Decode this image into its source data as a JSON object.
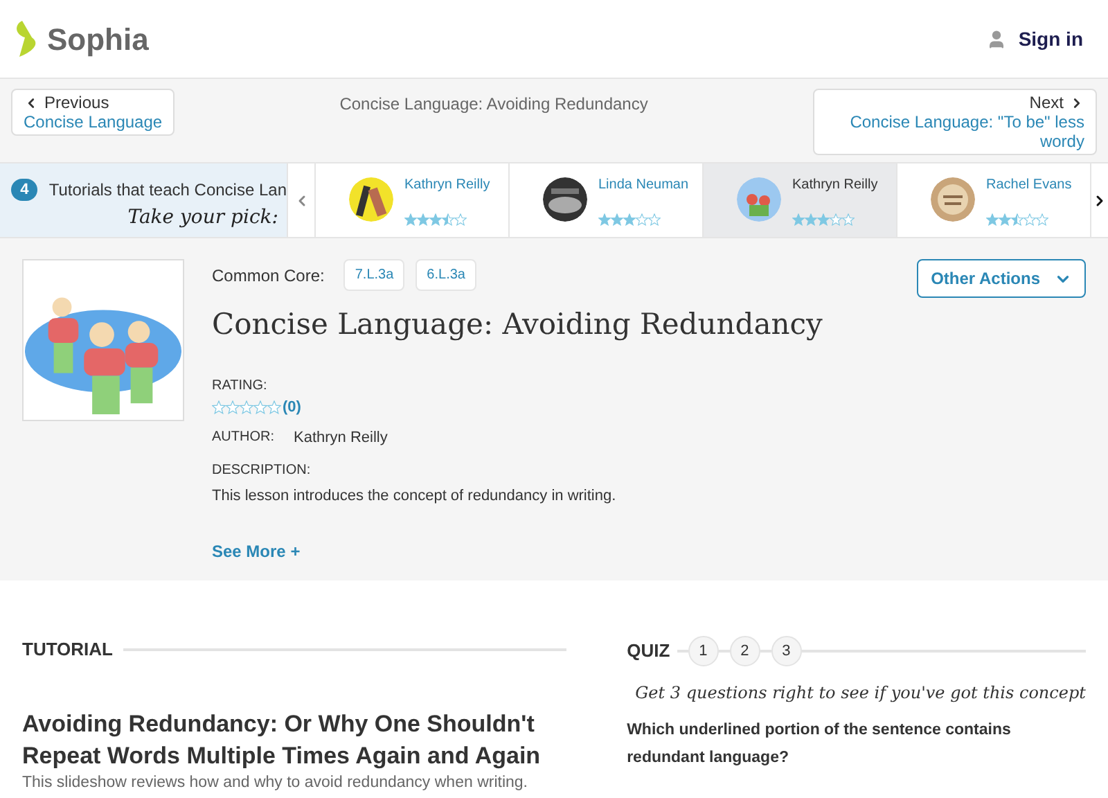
{
  "header": {
    "logo": "Sophia",
    "sign_in": "Sign in"
  },
  "nav": {
    "previous_label": "Previous",
    "previous_title": "Concise Language",
    "current": "Concise Language: Avoiding Redundancy",
    "next_label": "Next",
    "next_title": "Concise Language: \"To be\" less wordy"
  },
  "carousel": {
    "count": "4",
    "intro": "Tutorials that teach Concise Lan",
    "pick": "Take your pick:",
    "items": [
      {
        "name": "Kathryn Reilly",
        "stars": 3.5,
        "selected": false
      },
      {
        "name": "Linda Neuman",
        "stars": 3,
        "selected": false
      },
      {
        "name": "Kathryn Reilly",
        "stars": 3,
        "selected": true
      },
      {
        "name": "Rachel Evans",
        "stars": 2.5,
        "selected": false
      }
    ]
  },
  "lesson": {
    "common_core_label": "Common Core:",
    "standards": [
      "7.L.3a",
      "6.L.3a"
    ],
    "other_actions": "Other Actions",
    "title": "Concise Language: Avoiding Redundancy",
    "rating_label": "RATING:",
    "rating": {
      "stars": 0
    },
    "rating_count": "(0)",
    "author_label": "AUTHOR:",
    "author": "Kathryn Reilly",
    "description_label": "DESCRIPTION:",
    "description": "This lesson introduces the concept of redundancy in writing.",
    "see_more": "See More +"
  },
  "tutorial": {
    "heading": "TUTORIAL",
    "title": "Avoiding Redundancy: Or Why One Shouldn't Repeat Words Multiple Times Again and Again",
    "summary": "This slideshow reviews how and why to avoid redundancy when writing."
  },
  "quiz": {
    "heading": "QUIZ",
    "steps": [
      "1",
      "2",
      "3"
    ],
    "tagline": "Get 3 questions right to see if you've got this concept",
    "question": "Which underlined portion of the sentence contains redundant language?"
  }
}
